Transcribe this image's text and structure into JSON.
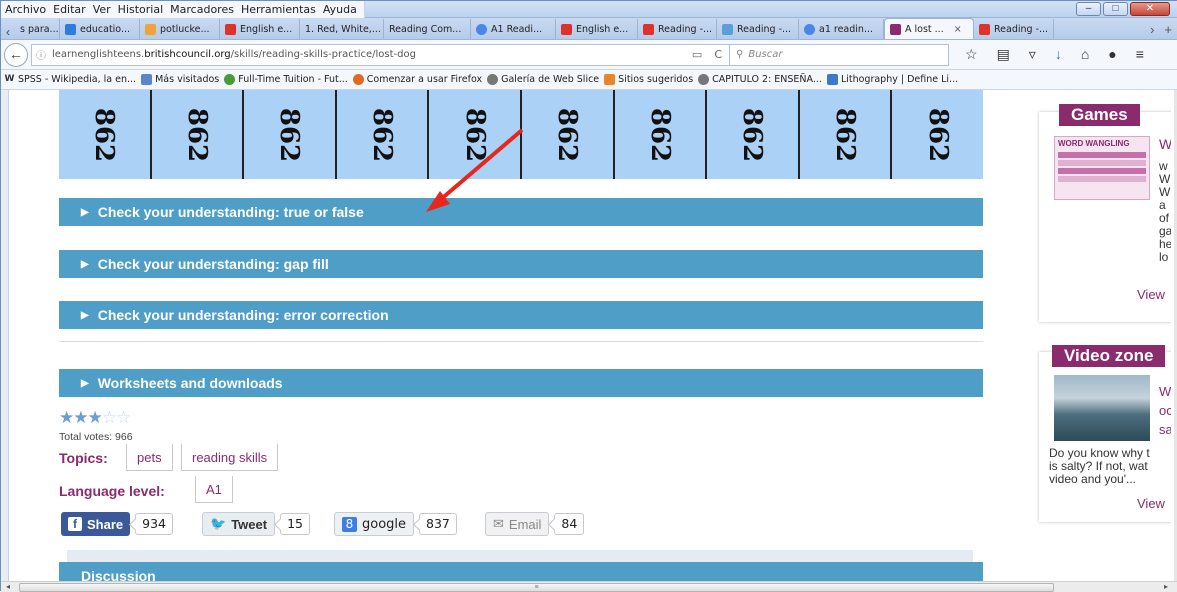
{
  "menu": [
    "Archivo",
    "Editar",
    "Ver",
    "Historial",
    "Marcadores",
    "Herramientas",
    "Ayuda"
  ],
  "window_controls": {
    "minimize": "–",
    "maximize": "□",
    "close": "✕"
  },
  "tabs": [
    {
      "label": "s para...",
      "color": "#ffffff"
    },
    {
      "label": "educatio...",
      "color": "#2d7de0"
    },
    {
      "label": "potlucke...",
      "color": "#f0a33a"
    },
    {
      "label": "English e...",
      "color": "#e0322a"
    },
    {
      "label": "1. Red, White,...",
      "color": "#dddddd"
    },
    {
      "label": "Reading Com...",
      "color": "#dddddd"
    },
    {
      "label": "A1 Readi...",
      "color": "#4a86e8"
    },
    {
      "label": "English e...",
      "color": "#e0322a"
    },
    {
      "label": "Reading -...",
      "color": "#e0322a"
    },
    {
      "label": "Reading -...",
      "color": "#5aa0d8"
    },
    {
      "label": "a1 readin...",
      "color": "#4a86e8"
    },
    {
      "label": "A lost ...",
      "color": "#8a2b6e",
      "active": true
    },
    {
      "label": "Reading -...",
      "color": "#e0322a"
    }
  ],
  "tab_close": "×",
  "url": {
    "prefix": "learnenglishteens.",
    "domain": "britishcouncil.org",
    "path": "/skills/reading-skills-practice/lost-dog"
  },
  "search_placeholder": "Buscar",
  "bookmarks": [
    "SPSS - Wikipedia, la en...",
    "Más visitados",
    "Full-Time Tuition - Fut...",
    "Comenzar a usar Firefox",
    "Galería de Web Slice",
    "Sitios sugeridos",
    "CAPITULO 2: ENSEÑA...",
    "Lithography | Define Li..."
  ],
  "number_strip": [
    "862",
    "862",
    "862",
    "862",
    "862",
    "862",
    "862",
    "862",
    "862",
    "862"
  ],
  "sections": {
    "true_false": "Check your understanding: true or false",
    "gap_fill": "Check your understanding: gap fill",
    "error_correction": "Check your understanding: error correction",
    "worksheets": "Worksheets and downloads",
    "discussion": "Discussion"
  },
  "rating": {
    "stars_filled": 3,
    "stars_total": 5,
    "votes_label": "Total votes: 966"
  },
  "topics": {
    "label": "Topics:",
    "items": [
      "pets",
      "reading skills"
    ]
  },
  "language_level": {
    "label": "Language level:",
    "value": "A1"
  },
  "share": {
    "facebook": {
      "label": "Share",
      "count": "934"
    },
    "twitter": {
      "label": "Tweet",
      "count": "15"
    },
    "google": {
      "label": "google",
      "count": "837"
    },
    "email": {
      "label": "Email",
      "count": "84"
    }
  },
  "sidebar": {
    "games": {
      "title": "Games",
      "thumb_title": "WORD WANGLING",
      "snippet": [
        "W",
        "w",
        "W",
        "W",
        "a",
        "of",
        "ga",
        "he",
        "lo"
      ],
      "view": "View"
    },
    "video": {
      "title": "Video zone",
      "snippet": [
        "W",
        "oc",
        "sa"
      ],
      "body": [
        "Do you know why t",
        "is salty? If not, wat",
        "video and you'..."
      ],
      "view": "View"
    }
  },
  "colors": {
    "accordion": "#4f9ec8",
    "brand": "#8a2b6e",
    "strip": "#abd1f7",
    "arrow": "#e8261c"
  }
}
